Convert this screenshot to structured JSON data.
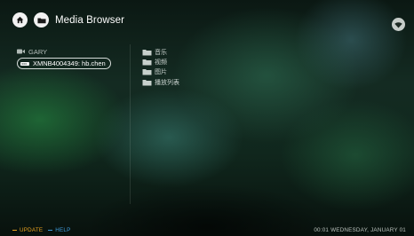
{
  "header": {
    "title": "Media Browser",
    "home_icon": "home-icon",
    "folder_icon": "folder-icon",
    "wifi_icon": "wifi-icon"
  },
  "sources": {
    "items": [
      {
        "label": "GARY",
        "icon": "video-camera-icon",
        "selected": false
      },
      {
        "label": "XMNB4004349: hb.chen",
        "icon": "network-drive-icon",
        "selected": true
      }
    ]
  },
  "folders": {
    "items": [
      {
        "label": "音乐",
        "icon": "folder-icon"
      },
      {
        "label": "视频",
        "icon": "folder-icon"
      },
      {
        "label": "图片",
        "icon": "folder-icon"
      },
      {
        "label": "播放列表",
        "icon": "folder-icon"
      }
    ]
  },
  "footer": {
    "update_label": "UPDATE",
    "help_label": "HELP",
    "update_color": "#e8a21f",
    "help_color": "#3f9ad8",
    "datetime": "00:01  WEDNESDAY, JANUARY 01"
  }
}
